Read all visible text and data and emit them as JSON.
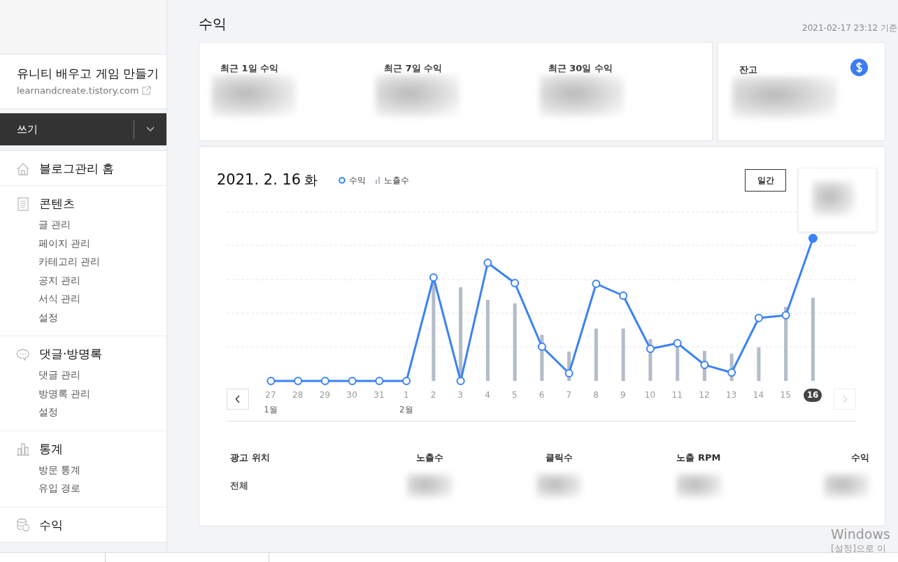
{
  "sidebar": {
    "blog_title": "유니티 배우고 게임 만들기",
    "blog_url": "learnandcreate.tistory.com",
    "write_button": "쓰기",
    "sections": [
      {
        "kind": "home",
        "title": "블로그관리 홈"
      },
      {
        "kind": "document",
        "title": "콘텐츠",
        "items": [
          "글 관리",
          "페이지 관리",
          "카테고리 관리",
          "공지 관리",
          "서식 관리",
          "설정"
        ]
      },
      {
        "kind": "comment",
        "title": "댓글·방명록",
        "items": [
          "댓글 관리",
          "방명록 관리",
          "설정"
        ]
      },
      {
        "kind": "stats",
        "title": "통계",
        "items": [
          "방문 통계",
          "유입 경로"
        ]
      },
      {
        "kind": "revenue",
        "title": "수익"
      }
    ]
  },
  "main": {
    "title": "수익",
    "timestamp": "2021-02-17 23:12 기준",
    "summary": [
      {
        "label": "최근 1일 수익"
      },
      {
        "label": "최근 7일 수익"
      },
      {
        "label": "최근 30일 수익"
      }
    ],
    "balance": {
      "label": "잔고"
    },
    "chart": {
      "date": "2021. 2. 16",
      "weekday": "화",
      "legend": [
        {
          "kind": "line",
          "label": "수익"
        },
        {
          "kind": "bar",
          "label": "노출수"
        }
      ],
      "periods": [
        {
          "label": "일간",
          "selected": true
        }
      ],
      "days": [
        {
          "label": "27",
          "month": "1월",
          "selected": false
        },
        {
          "label": "28",
          "selected": false
        },
        {
          "label": "29",
          "selected": false
        },
        {
          "label": "30",
          "selected": false
        },
        {
          "label": "31",
          "selected": false
        },
        {
          "label": "1",
          "month": "2월",
          "selected": false
        },
        {
          "label": "2",
          "selected": false
        },
        {
          "label": "3",
          "selected": false
        },
        {
          "label": "4",
          "selected": false
        },
        {
          "label": "5",
          "selected": false
        },
        {
          "label": "6",
          "selected": false
        },
        {
          "label": "7",
          "selected": false
        },
        {
          "label": "8",
          "selected": false
        },
        {
          "label": "9",
          "selected": false
        },
        {
          "label": "10",
          "selected": false
        },
        {
          "label": "11",
          "selected": false
        },
        {
          "label": "12",
          "selected": false
        },
        {
          "label": "13",
          "selected": false
        },
        {
          "label": "14",
          "selected": false
        },
        {
          "label": "15",
          "selected": false
        },
        {
          "label": "16",
          "selected": true
        }
      ]
    },
    "table": {
      "columns": [
        "광고 위치",
        "노출수",
        "클릭수",
        "노출 RPM",
        "수익"
      ],
      "rows": [
        {
          "cells": [
            "전체"
          ]
        }
      ]
    }
  },
  "watermark": {
    "line_1": "Windows",
    "line_2": "[설정]으로 이"
  }
}
